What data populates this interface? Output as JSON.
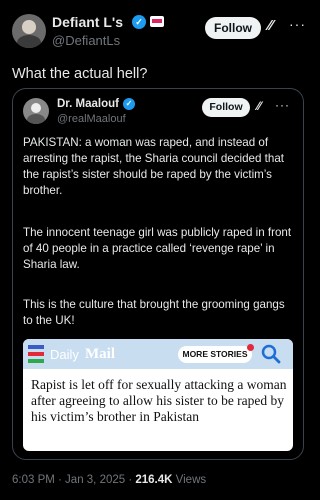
{
  "post": {
    "author_name": "Defiant L's",
    "author_handle": "@DefiantLs",
    "follow_label": "Follow",
    "text": "What the actual hell?",
    "time": "6:03 PM · Jan 3, 2025 · ",
    "views_count": "216.4K",
    "views_label": " Views"
  },
  "quoted": {
    "author_name": "Dr. Maalouf",
    "author_handle": "@realMaalouf",
    "follow_label": "Follow",
    "paragraphs": [
      "PAKISTAN: a woman was raped, and instead of arresting the rapist, the Sharia council decided that the rapist’s sister should be raped by the victim’s brother.",
      "The innocent teenage girl was publicly raped in front of 40 people in a practice called ‘revenge rape’ in Sharia law.",
      "This is the culture that brought the grooming gangs to the UK!"
    ]
  },
  "card": {
    "logo_daily": "Daily",
    "logo_mail": "Mail",
    "more_stories": "MORE STORIES",
    "headline": "Rapist is let off for sexually attacking a woman after agreeing to allow his sister to be raped by his victim’s brother in Pakistan"
  },
  "icons": {
    "verified": "verified-badge-icon",
    "flag": "affiliate-flag-icon",
    "grok": "grok-icon",
    "more": "more-options-icon",
    "search": "search-icon",
    "menu": "hamburger-menu-icon"
  },
  "colors": {
    "background": "#000000",
    "verified": "#1d9bf0",
    "dailymail_header": "#c8ddf0",
    "search_icon": "#1d9bf0"
  }
}
